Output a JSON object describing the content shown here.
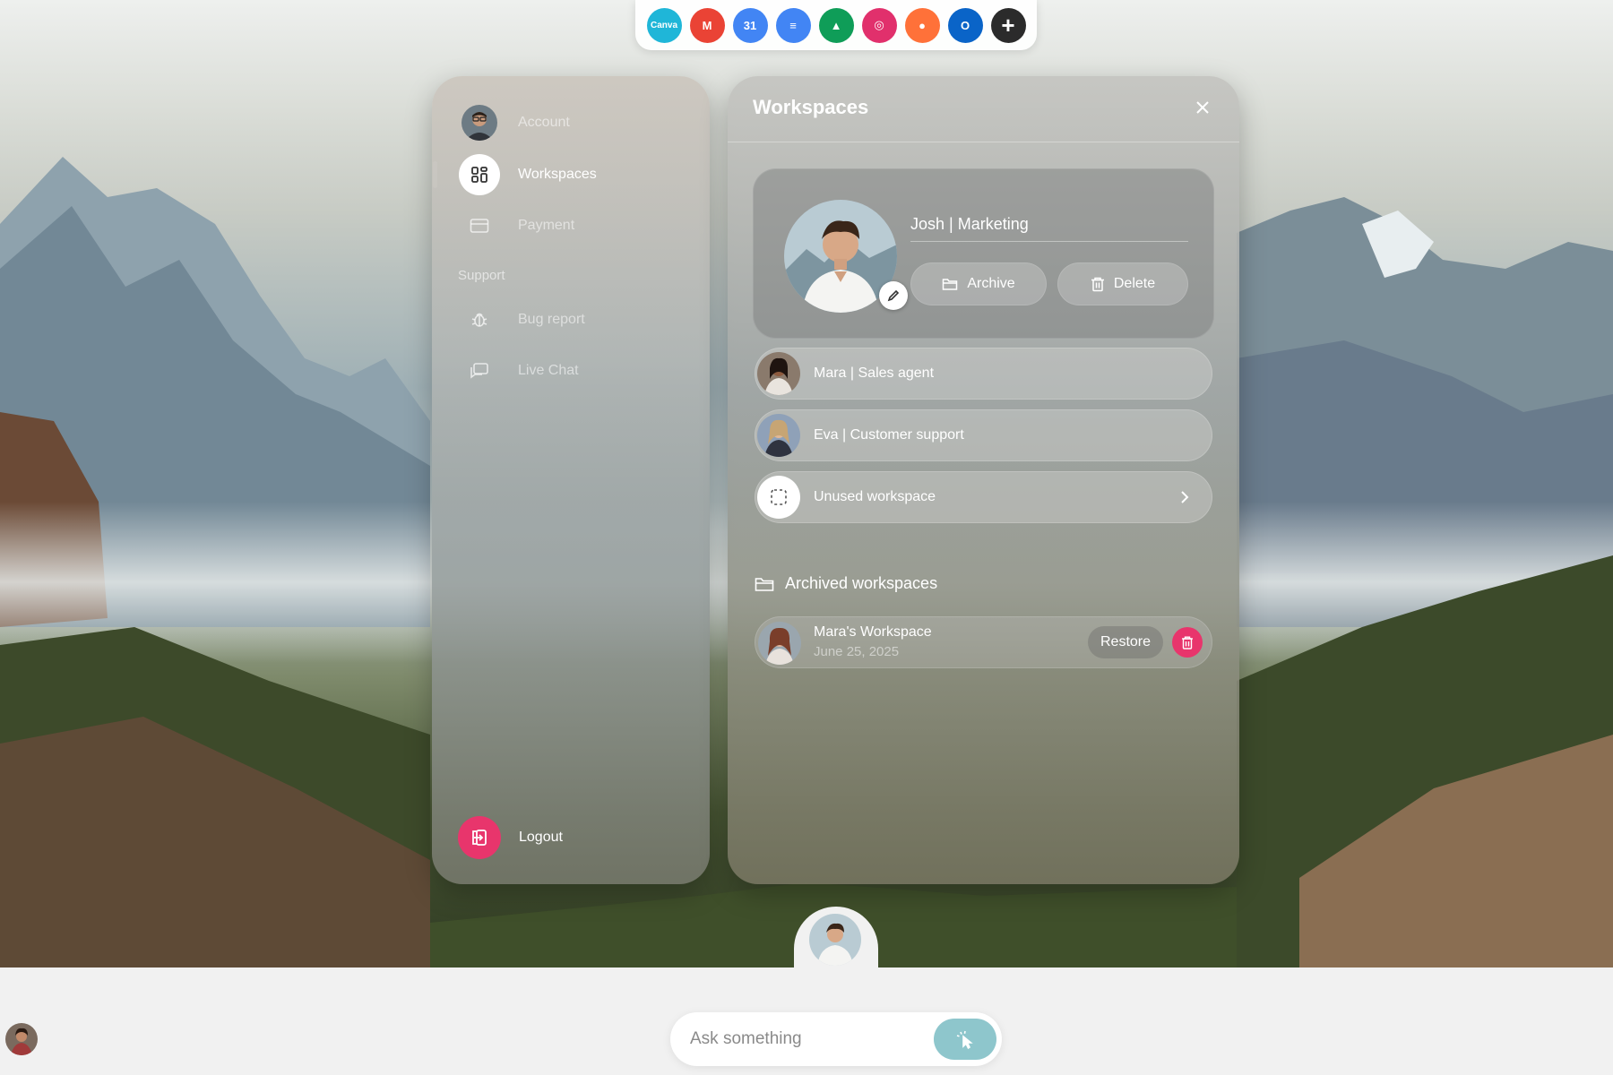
{
  "dock": {
    "apps": [
      {
        "name": "Canva",
        "icon": "canva-icon",
        "color": "#1fb6d8",
        "glyph": "Canva"
      },
      {
        "name": "Gmail",
        "icon": "gmail-icon",
        "color": "#ea4335",
        "glyph": "M"
      },
      {
        "name": "Google Calendar",
        "icon": "calendar-icon",
        "color": "#4285f4",
        "glyph": "31"
      },
      {
        "name": "Google Docs",
        "icon": "docs-icon",
        "color": "#4285f4",
        "glyph": "≡"
      },
      {
        "name": "Google Drive",
        "icon": "drive-icon",
        "color": "#0f9d58",
        "glyph": "▲"
      },
      {
        "name": "Instagram",
        "icon": "instagram-icon",
        "color": "#e1306c",
        "glyph": "◎"
      },
      {
        "name": "Firefox",
        "icon": "firefox-icon",
        "color": "#ff7139",
        "glyph": "●"
      },
      {
        "name": "Outlook",
        "icon": "outlook-icon",
        "color": "#0a64c8",
        "glyph": "O"
      },
      {
        "name": "Add app",
        "icon": "plus-icon",
        "color": "#2b2b2b",
        "glyph": "+"
      }
    ]
  },
  "sidebar": {
    "items": [
      {
        "label": "Account",
        "icon": "avatar-icon"
      },
      {
        "label": "Workspaces",
        "icon": "grid-icon"
      },
      {
        "label": "Payment",
        "icon": "card-icon"
      }
    ],
    "section_label": "Support",
    "support_items": [
      {
        "label": "Bug report",
        "icon": "bug-icon"
      },
      {
        "label": "Live Chat",
        "icon": "chat-icon"
      }
    ],
    "logout_label": "Logout",
    "accent_color": "#e8356c"
  },
  "main": {
    "title": "Workspaces",
    "current_workspace": {
      "name": "Josh | Marketing",
      "archive_label": "Archive",
      "delete_label": "Delete"
    },
    "workspaces": [
      {
        "label": "Mara | Sales agent"
      },
      {
        "label": "Eva | Customer support"
      },
      {
        "label": "Unused workspace"
      }
    ],
    "archived": {
      "heading": "Archived workspaces",
      "items": [
        {
          "name": "Mara's Workspace",
          "date": "June 25, 2025",
          "restore_label": "Restore"
        }
      ]
    }
  },
  "ask": {
    "placeholder": "Ask something",
    "accent_color": "#8ec6cc"
  }
}
